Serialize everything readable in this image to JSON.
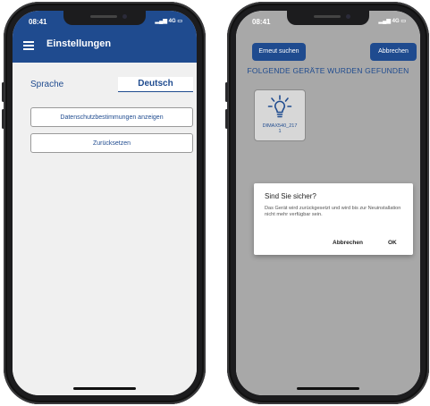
{
  "status_bar": {
    "time": "08:41",
    "network": "4G"
  },
  "left_screen": {
    "header_title": "Einstellungen",
    "language_label": "Sprache",
    "language_value": "Deutsch",
    "privacy_button": "Datenschutzbestimmungen anzeigen",
    "reset_button": "Zurücksetzen"
  },
  "right_screen": {
    "search_again_button": "Erneut suchen",
    "cancel_button": "Abbrechen",
    "found_title": "FOLGENDE GERÄTE WURDEN GEFUNDEN",
    "device": {
      "name_line1": "DIMAX540_217",
      "name_line2": "1"
    },
    "dialog": {
      "title": "Sind Sie sicher?",
      "message": "Das Gerät wird zurückgesetzt und wird bis zur Neuinstallation nicht mehr verfügbar sein.",
      "cancel": "Abbrechen",
      "ok": "OK"
    }
  },
  "colors": {
    "primary": "#1f4b8f",
    "background": "#f0f0f0",
    "overlay": "#a8a8a8"
  }
}
